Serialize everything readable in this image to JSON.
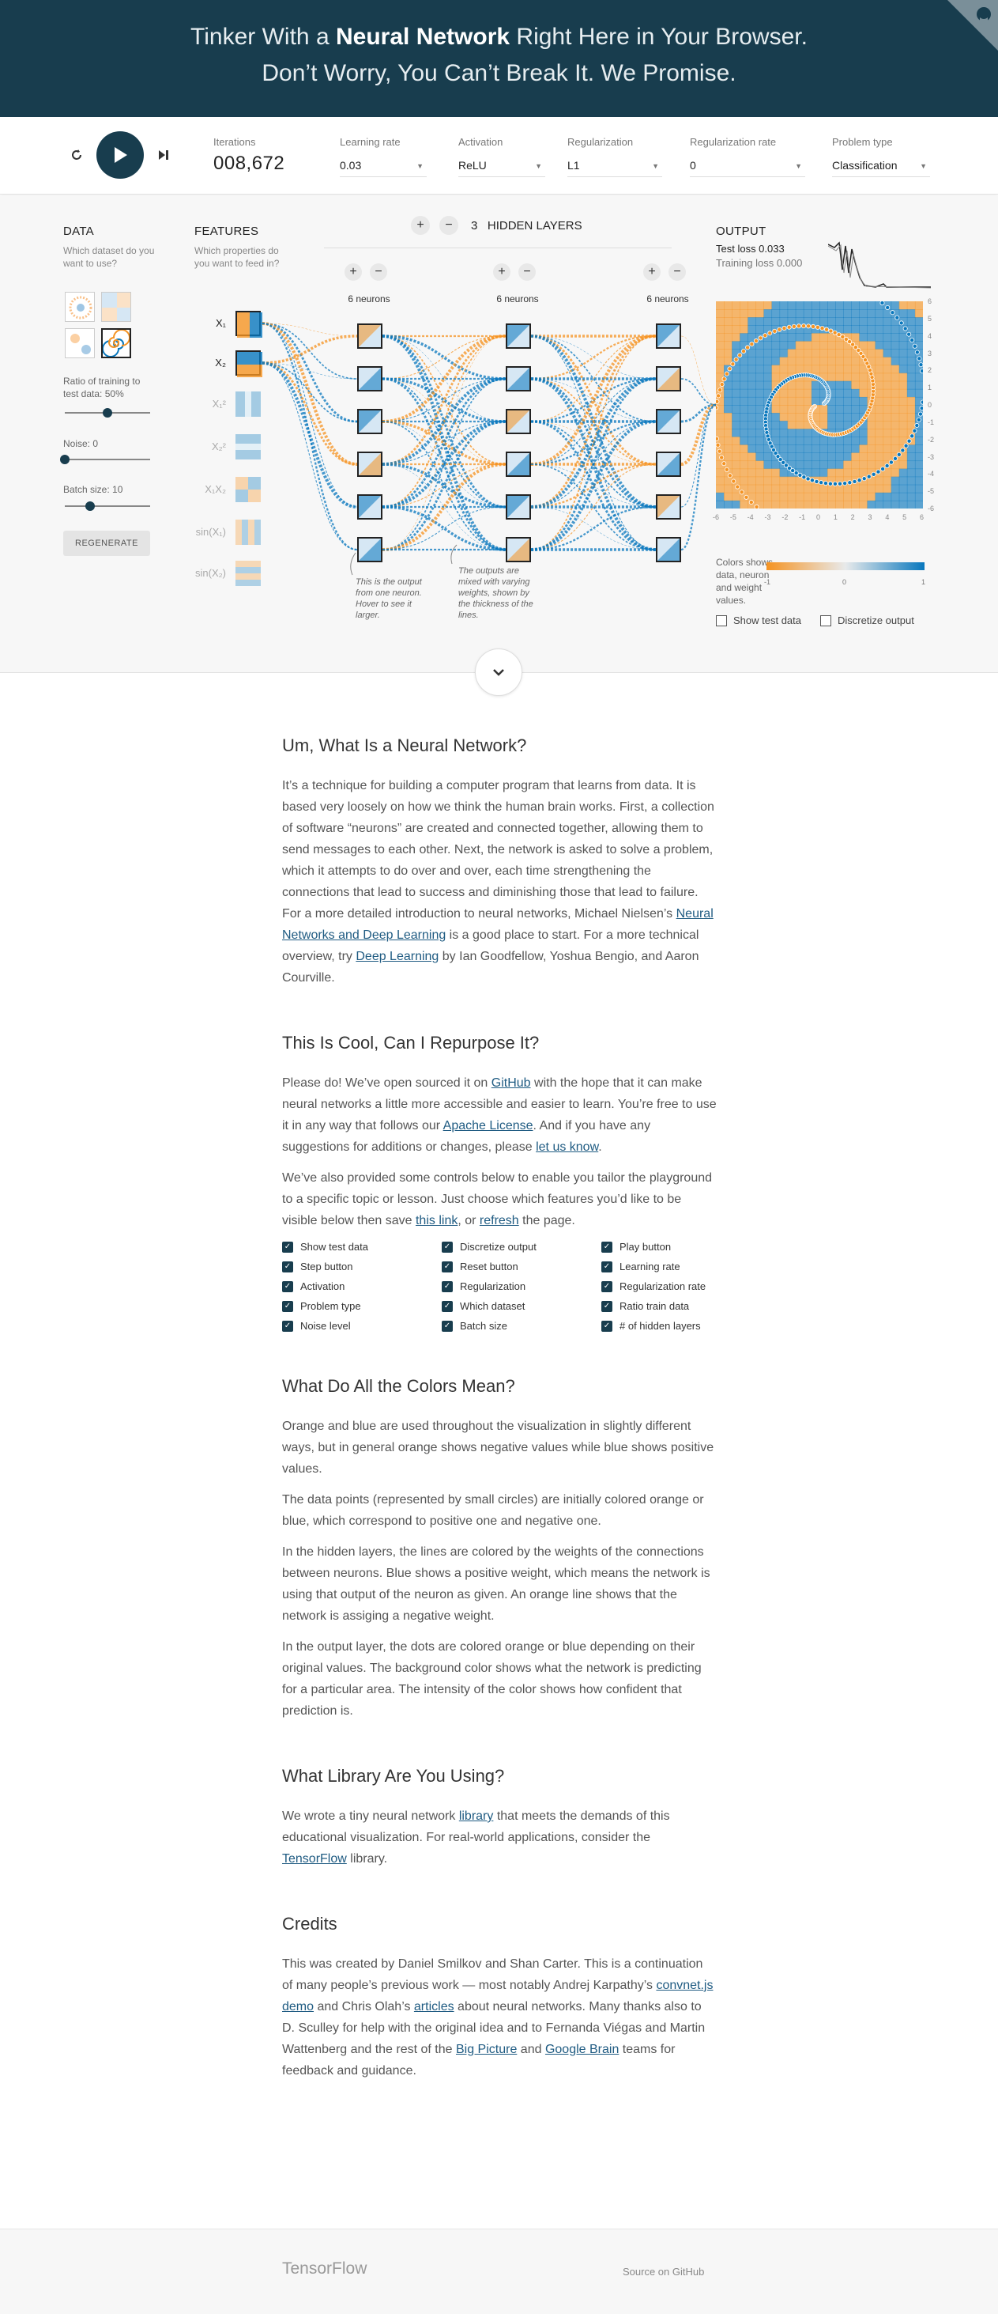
{
  "header": {
    "line1_pre": "Tinker With a",
    "line1_bold": "Neural Network",
    "line1_post": "Right Here in Your Browser.",
    "line2": "Don’t Worry, You Can’t Break It. We Promise."
  },
  "controls": {
    "iterations_label": "Iterations",
    "iterations_value": "008,672",
    "learning_rate_label": "Learning rate",
    "learning_rate_value": "0.03",
    "activation_label": "Activation",
    "activation_value": "ReLU",
    "regularization_label": "Regularization",
    "regularization_value": "L1",
    "regularization_rate_label": "Regularization rate",
    "regularization_rate_value": "0",
    "problem_type_label": "Problem type",
    "problem_type_value": "Classification"
  },
  "data_panel": {
    "title": "DATA",
    "subtitle": "Which dataset do you want to use?",
    "ratio_label": "Ratio of training to test data:",
    "ratio_value": "50%",
    "ratio_fraction": 0.5,
    "noise_label": "Noise:",
    "noise_value": "0",
    "noise_fraction": 0.0,
    "batch_label": "Batch size:",
    "batch_value": "10",
    "batch_fraction": 0.3,
    "regenerate": "REGENERATE"
  },
  "features": {
    "title": "FEATURES",
    "subtitle": "Which properties do you want to feed in?",
    "items": [
      {
        "label": "X₁",
        "active": true
      },
      {
        "label": "X₂",
        "active": true
      },
      {
        "label": "X₁²",
        "active": false
      },
      {
        "label": "X₂²",
        "active": false
      },
      {
        "label": "X₁X₂",
        "active": false
      },
      {
        "label": "sin(X₁)",
        "active": false
      },
      {
        "label": "sin(X₂)",
        "active": false
      }
    ]
  },
  "network": {
    "hidden_layers_count": "3",
    "hidden_layers_label": "HIDDEN LAYERS",
    "layers": [
      {
        "neurons_label": "6 neurons",
        "count": 6
      },
      {
        "neurons_label": "6 neurons",
        "count": 6
      },
      {
        "neurons_label": "6 neurons",
        "count": 6
      }
    ],
    "plus": "+",
    "minus": "−",
    "note1": "This is the output from one neuron. Hover to see it larger.",
    "note2": "The outputs are mixed with varying weights, shown by the thickness of the lines."
  },
  "output": {
    "title": "OUTPUT",
    "test_loss": "Test loss 0.033",
    "training_loss": "Training loss 0.000",
    "y_ticks": [
      "6",
      "5",
      "4",
      "3",
      "2",
      "1",
      "0",
      "-1",
      "-2",
      "-3",
      "-4",
      "-5",
      "-6"
    ],
    "x_ticks": [
      "-6",
      "-5",
      "-4",
      "-3",
      "-2",
      "-1",
      "0",
      "1",
      "2",
      "3",
      "4",
      "5",
      "6"
    ],
    "legend_text": "Colors shows data, neuron and weight values.",
    "legend_ticks": [
      "-1",
      "0",
      "1"
    ],
    "show_test_data": "Show test data",
    "discretize_output": "Discretize output",
    "colors": {
      "orange": "#f59322",
      "blue": "#0877bd",
      "navy": "#183d4e"
    }
  },
  "article": {
    "s1_title": "Um, What Is a Neural Network?",
    "s1_p1_a": "It’s a technique for building a computer program that learns from data. It is based very loosely on how we think the human brain works. First, a collection of software “neurons” are created and connected together, allowing them to send messages to each other. Next, the network is asked to solve a problem, which it attempts to do over and over, each time strengthening the connections that lead to success and diminishing those that lead to failure. For a more detailed introduction to neural networks, Michael Nielsen’s ",
    "s1_link1": "Neural Networks and Deep Learning",
    "s1_p1_b": " is a good place to start. For a more technical overview, try ",
    "s1_link2": "Deep Learning",
    "s1_p1_c": " by Ian Goodfellow, Yoshua Bengio, and Aaron Courville.",
    "s2_title": "This Is Cool, Can I Repurpose It?",
    "s2_p1_a": "Please do! We’ve open sourced it on ",
    "s2_link_github": "GitHub",
    "s2_p1_b": " with the hope that it can make neural networks a little more accessible and easier to learn. You’re free to use it in any way that follows our ",
    "s2_link_license": "Apache License",
    "s2_p1_c": ". And if you have any suggestions for additions or changes, please ",
    "s2_link_letus": "let us know",
    "s2_p1_d": ".",
    "s2_p2_a": "We’ve also provided some controls below to enable you tailor the playground to a specific topic or lesson. Just choose which features you’d like to be visible below then save ",
    "s2_link_this": "this link",
    "s2_p2_b": ", or ",
    "s2_link_refresh": "refresh",
    "s2_p2_c": " the page.",
    "checkboxes": [
      "Show test data",
      "Discretize output",
      "Play button",
      "Step button",
      "Reset button",
      "Learning rate",
      "Activation",
      "Regularization",
      "Regularization rate",
      "Problem type",
      "Which dataset",
      "Ratio train data",
      "Noise level",
      "Batch size",
      "# of hidden layers"
    ],
    "s3_title": "What Do All the Colors Mean?",
    "s3_p1": "Orange and blue are used throughout the visualization in slightly different ways, but in general orange shows negative values while blue shows positive values.",
    "s3_p2": "The data points (represented by small circles) are initially colored orange or blue, which correspond to positive one and negative one.",
    "s3_p3": "In the hidden layers, the lines are colored by the weights of the connections between neurons. Blue shows a positive weight, which means the network is using that output of the neuron as given. An orange line shows that the network is assiging a negative weight.",
    "s3_p4": "In the output layer, the dots are colored orange or blue depending on their original values. The background color shows what the network is predicting for a particular area. The intensity of the color shows how confident that prediction is.",
    "s4_title": "What Library Are You Using?",
    "s4_p_a": "We wrote a tiny neural network ",
    "s4_link_library": "library",
    "s4_p_b": " that meets the demands of this educational visualization. For real-world applications, consider the ",
    "s4_link_tf": "TensorFlow",
    "s4_p_c": " library.",
    "s5_title": "Credits",
    "s5_p_a": "This was created by Daniel Smilkov and Shan Carter. This is a continuation of many people’s previous work — most notably Andrej Karpathy’s ",
    "s5_link_convnet": "convnet.js demo",
    "s5_p_b": " and Chris Olah’s ",
    "s5_link_articles": "articles",
    "s5_p_c": " about neural networks. Many thanks also to D. Sculley for help with the original idea and to Fernanda Viégas and Martin Wattenberg and the rest of the ",
    "s5_link_bigpicture": "Big Picture",
    "s5_p_d": " and ",
    "s5_link_brain": "Google Brain",
    "s5_p_e": " teams for feedback and guidance."
  },
  "footer": {
    "brand": "TensorFlow",
    "source": "Source on GitHub"
  }
}
